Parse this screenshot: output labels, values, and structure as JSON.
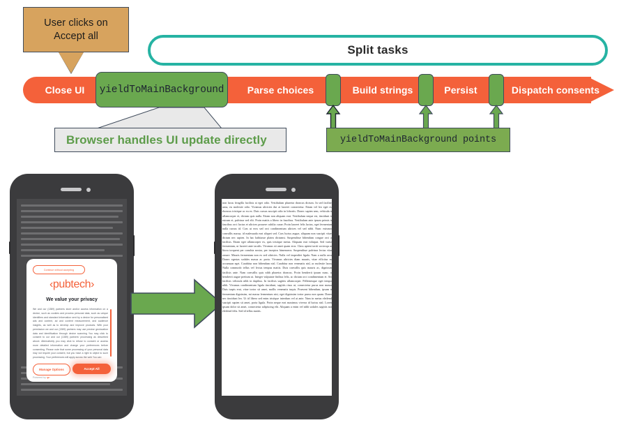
{
  "diagram": {
    "callout": {
      "line1": "User clicks on",
      "line2": "Accept all",
      "text": "User clicks on Accept all",
      "bg_color": "#d7a35e",
      "border_color": "#3f4b5b"
    },
    "split_pill": {
      "label": "Split tasks",
      "border_color": "#26b3a3",
      "fill_color": "#ffffff"
    },
    "timeline": {
      "bar_color": "#f4613a",
      "segments": [
        {
          "label": "Close UI"
        },
        {
          "label": "Parse choices"
        },
        {
          "label": "Build strings"
        },
        {
          "label": "Persist"
        },
        {
          "label": "Dispatch consents"
        }
      ],
      "yield_box": {
        "label": "yieldToMainBackground",
        "fill_color": "#6aa84f",
        "border_color": "#3f4b5b"
      },
      "yield_points_count": 3
    },
    "note_browser": {
      "label": "Browser handles UI update directly",
      "text_color": "#5d9c4a",
      "bg_color": "#e9e9e9"
    },
    "note_points": {
      "label": "yieldToMainBackground points",
      "bg_color": "#7cab50",
      "border_color": "#3f4b5b"
    },
    "flow_arrow": {
      "name": "transition-arrow",
      "fill_color": "#6aa84f",
      "border_color": "#3f4b5b"
    }
  },
  "phone_before": {
    "consent_modal": {
      "continue_without_accepting": "Continue without accepting",
      "brand": "‹pubtech›",
      "headline": "We value your privacy",
      "body": "We and our (1389) partners store and/or access information on a device, such as cookies and process personal data, such as unique identifiers and standard information sent by a device for personalised ads and content, ad and content measurement, and audience insights, as well as to develop and improve products. With your permission we and our (1389) partners may use precise geolocation data and identification through device scanning You may click to consent to our and our (1389) partners' processing as described above. Alternatively you may click to refuse to consent or access more detailed information and change your preferences before consenting. Please note that some processing of your personal data may not require your consent, but you have a right to object to such processing. Your preferences will apply across the web You can",
      "partners_link": "(1389) partners",
      "manage_options_label": "Manage Options",
      "accept_all_label": "Accept All",
      "powered_by": "Powered by",
      "powered_by_brand": "‹p›",
      "accent_color": "#f4613a"
    }
  },
  "phone_after": {
    "page_text": "non lacus fringilla facilisis at eget odio. Vestibulum pharetra rhoncus dictum. In sed facilisis urna, eu molestie odio. Vivamus ultricies dui at laoreet consectetur. Etiam vel leo eget est rhoncus tristique ac eu ex. Duis cursus suscipit odio in lobortis. Donec sapien sem, vehicula in ullamcorper et, dictum quis nulla. Etiam non aliquam erat. Vestibulum neque est, tincidunt id rutrum et, pulvinar sed elit. Proin mattis a libero in faucibus. Vestibulum ante ipsum primis in faucibus orci luctus et ultrices posuere cubilia curae; Proin laoreet felis luctus, eget fermentum nulla cursus id. Cras ut eros sed orci condimentum ultrices vel sed nibh. Nunc euismod convallis massa, id malesuada erat aliquet sed. Cras luctus augue, aliquam non suscipit vitae, dictum nec sapien. In hac habitasse platea dictumst. Suspendisse bibendum congue orci at facilisis. Etiam eget ullamcorper ex, quis tristique metus. Aliquam erat volutpat. Sed varius fermentum, ut laoreet ante iaculis. Vivamus sit amet quam eros. Class aptent taciti sociosqu ad litora torquent per conubia nostra, per inceptos himenaeos. Suspendisse pulvinar lectus vitae ornare. Mauris fermentum non ex sed ultricies. Nulla vel imperdiet ligula. Nam a nulla arcu. Donec egestas sodales massa ac porta. Vivamus ultricies diam mauris, vitae efficitur mi accumsan eget. Curabitur non bibendum nisl. Curabitur non venenatis nisl, ac molestie lacus. Nulla commodo tellus vel lectus tempus mattis. Duis convallis quis mauris ac, dignissim facilisis ante. Nam convallis quis nibh pharetra rhoncus. Proin hendrerit ipsum nunc, ut hendrerit augue pretium ut. Integer vulputate finibus felis, ac dictum orci condimentum et. Sed facilisis vehicula nibh in dapibus. In facilisis sagittis ullamcorper. Pellentesque eget tempor nibh. Vivamus condimentum ligula tincidunt, sagittis risus ut, consectetur purus non massa. Duis turpis erat, vitae tortor sit amet, mollis venenatis turpis. Praesent bibendum, ipsum in fermentum dignissim, mi massa fermentum nisi, eget dignissim tortor purus non quam. Donec nec tincidunt leo. Ut id libero sed enim tristique interdum vel at ante. Nam in metus eleifend, suscipit sapien sit amet, porta ligula. Proin neque erat maximus viverra id luctus nisl. Lorem ipsum dolor sit amet, consectetur adipiscing elit. Aliquam a enim vel nibh sodales sagittis non eleifend felis. Sed id tellus mattis."
  }
}
